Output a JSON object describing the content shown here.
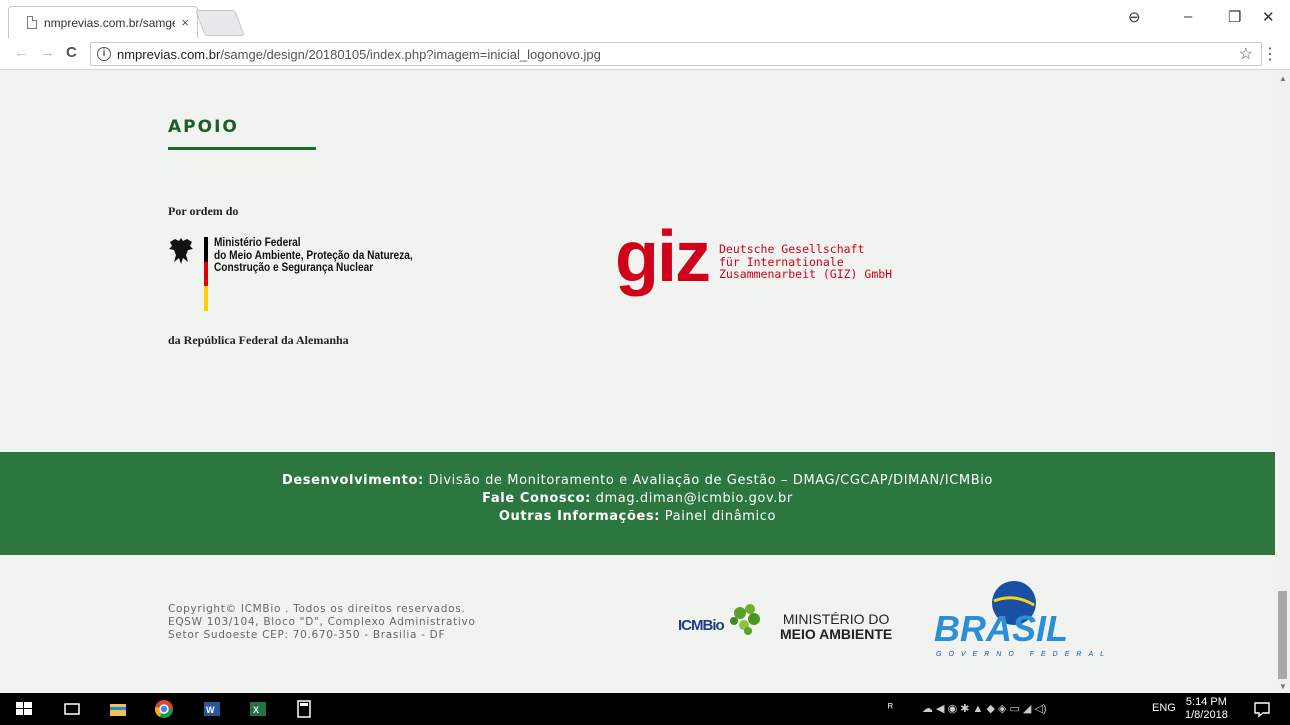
{
  "browser": {
    "tab_title": "nmprevias.com.br/samge",
    "tab_close": "×",
    "url_domain": "nmprevias.com.br",
    "url_path": "/samge/design/20180105/index.php?imagem=inicial_logonovo.jpg",
    "info_glyph": "i",
    "back_glyph": "←",
    "forward_glyph": "→",
    "reload_glyph": "C",
    "star_glyph": "☆",
    "menu_glyph": "⋮",
    "profile_glyph": "⊖",
    "minimize_glyph": "–",
    "restore_glyph": "❐",
    "close_glyph": "✕"
  },
  "apoio": {
    "title": "APOIO",
    "por_ordem": "Por ordem do",
    "ministerio_lines": [
      "Ministério Federal",
      "do Meio Ambiente, Proteção da Natureza,",
      "Construção e Segurança Nuclear"
    ],
    "da_republica": "da República Federal da Alemanha",
    "giz_mark": "giz",
    "giz_lines": [
      "Deutsche Gesellschaft",
      "für Internationale",
      "Zusammenarbeit (GIZ) GmbH"
    ]
  },
  "footer_band": {
    "dev_label": "Desenvolvimento:",
    "dev_value": " Divisão de Monitoramento e Avaliação de Gestão – DMAG/CGCAP/DIMAN/ICMBio",
    "contact_label": "Fale Conosco:",
    "contact_value": " dmag.diman@icmbio.gov.br",
    "info_label": "Outras Informações:",
    "info_value": " Painel dinâmico"
  },
  "footer": {
    "copyright_lines": [
      "Copyright© ICMBio . Todos os direitos reservados.",
      "EQSW 103/104, Bloco \"D\", Complexo Administrativo",
      "Setor Sudoeste CEP: 70.670-350 - Brasilia - DF"
    ],
    "icmbio_logo_text": "ICMBio",
    "mma_line1": "MINISTÉRIO DO",
    "mma_line2": "MEIO AMBIENTE",
    "brasil_text": "BRASIL",
    "governo_text": "GOVERNO FEDERAL"
  },
  "taskbar": {
    "language": "ENG",
    "time": "5:14 PM",
    "date": "1/8/2018"
  },
  "colors": {
    "accent_green": "#2c7640",
    "giz_red": "#d0021b",
    "title_green": "#1d5d2c"
  }
}
